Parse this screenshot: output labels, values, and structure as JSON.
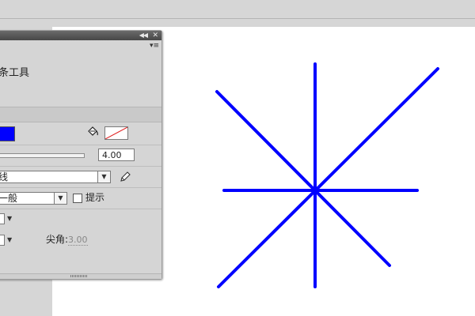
{
  "panel": {
    "tool_name": "条工具",
    "menu_glyph": "▾≡",
    "stroke_size": "4.00",
    "stroke_style": "线",
    "scale_value": "一般",
    "hint_label": "提示",
    "miter_label": "尖角:",
    "miter_value": "3.00"
  },
  "colors": {
    "stroke_color": "#0000ff",
    "fill": "none",
    "stage_background": "#ffffff",
    "panel_background": "#d5d5d5"
  },
  "canvas": {
    "shape": "eight-line star",
    "stroke_color": "#0000ff"
  },
  "icons": [
    "collapse-icon",
    "close-icon",
    "panel-menu-icon",
    "paint-bucket-icon",
    "pencil-icon",
    "dropdown-arrow-icon"
  ]
}
